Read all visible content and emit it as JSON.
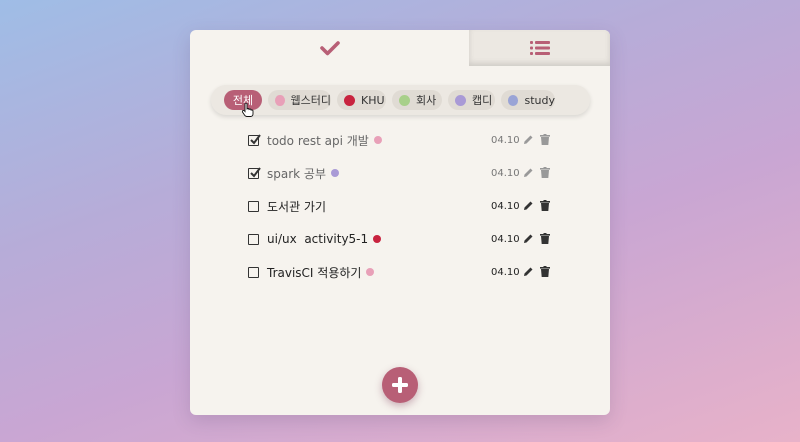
{
  "tabs": [
    {
      "name": "check-icon",
      "active": true
    },
    {
      "name": "list-icon",
      "active": false
    }
  ],
  "filters": [
    {
      "label": "전체",
      "active": true
    },
    {
      "label": "웹스터디",
      "color": "#e8a0b8"
    },
    {
      "label": "KHU",
      "color": "#c8233f"
    },
    {
      "label": "회사",
      "color": "#a8d08a"
    },
    {
      "label": "캡디",
      "color": "#a99ad6"
    },
    {
      "label": "study",
      "color": "#9aa4d6"
    }
  ],
  "todos": [
    {
      "title": "todo rest api 개발",
      "date": "04.10",
      "done": true,
      "tag_color": "#e8a0b8"
    },
    {
      "title": "spark 공부",
      "date": "04.10",
      "done": true,
      "tag_color": "#a99ad6"
    },
    {
      "title": "도서관 가기",
      "date": "04.10",
      "done": false
    },
    {
      "title": "ui/ux  activity5-1",
      "date": "04.10",
      "done": false,
      "tag_color": "#c8233f"
    },
    {
      "title": "TravisCI 적용하기",
      "date": "04.10",
      "done": false,
      "tag_color": "#e8a0b8"
    }
  ],
  "colors": {
    "accent": "#b85f76",
    "card": "#f6f3ee"
  },
  "icons": {
    "add": "plus-icon",
    "edit": "pencil-icon",
    "delete": "trash-icon"
  }
}
